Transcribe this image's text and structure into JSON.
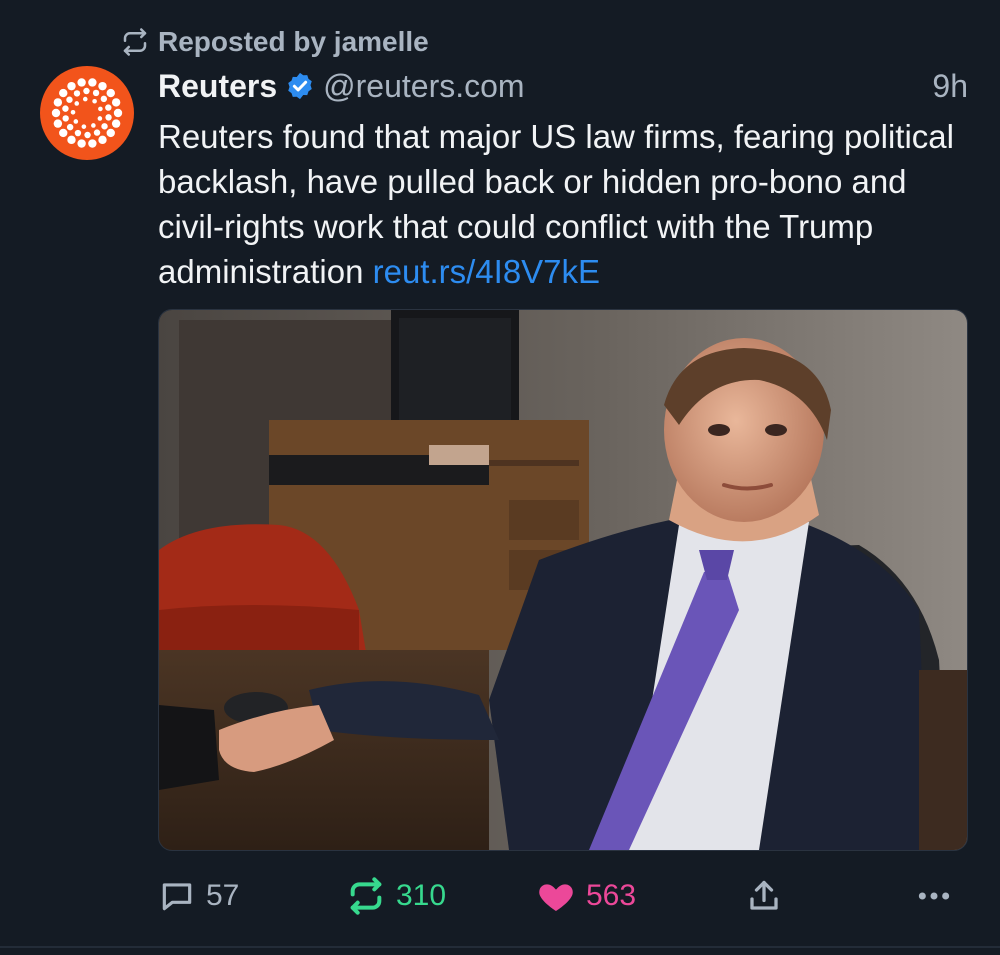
{
  "colors": {
    "background": "#141b24",
    "accent_blue": "#2d8cf0",
    "repost_green": "#37d98e",
    "like_pink": "#ec4899",
    "muted_text": "#a9b4c1",
    "reuters_orange": "#f2541b"
  },
  "repost": {
    "icon": "repost-icon",
    "label": "Reposted by jamelle"
  },
  "author": {
    "avatar_icon": "reuters-logo",
    "name": "Reuters",
    "verified_icon": "verified-badge-icon",
    "handle": "@reuters.com"
  },
  "post": {
    "timestamp": "9h",
    "text": "Reuters found that major US law firms, fearing political backlash, have pulled back or hidden pro-bono and civil-rights work that could conflict with the Trump administration ",
    "link": "reut.rs/4I8V7kE"
  },
  "media": {
    "type": "photo"
  },
  "actions": {
    "reply": {
      "icon": "reply-icon",
      "count": "57"
    },
    "repost": {
      "icon": "repost-icon",
      "count": "310"
    },
    "like": {
      "icon": "heart-icon",
      "count": "563"
    },
    "share": {
      "icon": "share-icon"
    },
    "more": {
      "icon": "more-icon"
    }
  }
}
